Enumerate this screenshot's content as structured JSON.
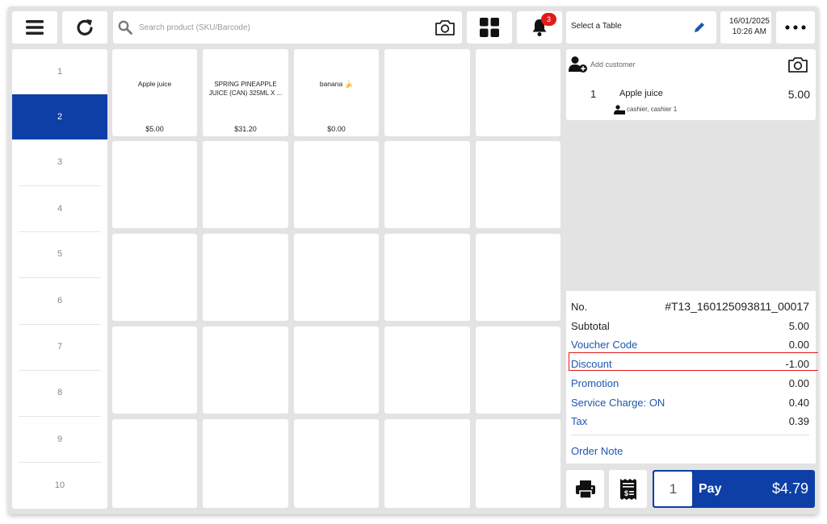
{
  "toolbar": {
    "search_placeholder": "Search product (SKU/Barcode)",
    "notification_count": "3",
    "table_select": "Select a Table",
    "date": "16/01/2025",
    "time": "10:26 AM"
  },
  "sidebar": {
    "items": [
      {
        "label": "1"
      },
      {
        "label": "2"
      },
      {
        "label": "3"
      },
      {
        "label": "4"
      },
      {
        "label": "5"
      },
      {
        "label": "6"
      },
      {
        "label": "7"
      },
      {
        "label": "8"
      },
      {
        "label": "9"
      },
      {
        "label": "10"
      }
    ],
    "active": "2"
  },
  "products": [
    {
      "name": "Apple juice",
      "price": "$5.00"
    },
    {
      "name": "SPRING PINEAPPLE JUICE (CAN) 325ML X ...",
      "price": "$31.20"
    },
    {
      "name": "banana 🍌",
      "price": "$0.00"
    }
  ],
  "order": {
    "add_customer": "Add customer",
    "line": {
      "qty": "1",
      "name": "Apple juice",
      "amount": "5.00",
      "staff": "cashier, cashier 1"
    },
    "summary": {
      "no_label": "No.",
      "no_value": "#T13_160125093811_00017",
      "subtotal_label": "Subtotal",
      "subtotal_value": "5.00",
      "voucher_label": "Voucher Code",
      "voucher_value": "0.00",
      "discount_label": "Discount",
      "discount_value": "-1.00",
      "promotion_label": "Promotion",
      "promotion_value": "0.00",
      "service_label": "Service Charge: ON",
      "service_value": "0.40",
      "tax_label": "Tax",
      "tax_value": "0.39",
      "note_label": "Order Note"
    }
  },
  "pay": {
    "qty": "1",
    "label": "Pay",
    "amount": "$4.79"
  },
  "colors": {
    "primary": "#0d3fa6",
    "link": "#1e56b0",
    "highlight": "#e21b1b"
  }
}
